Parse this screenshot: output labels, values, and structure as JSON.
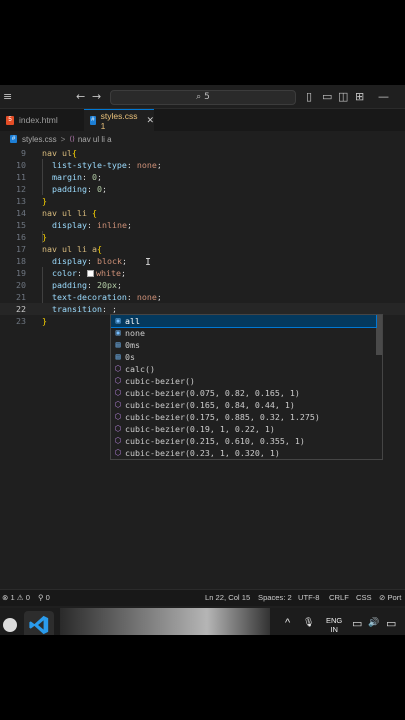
{
  "titlebar": {
    "menu_icon": "≡",
    "back_icon": "←",
    "forward_icon": "→",
    "search_text": "⌕ 5",
    "layout_icons": [
      "▯",
      "▭",
      "◫",
      "⊞"
    ],
    "minimize": "—"
  },
  "tabs": [
    {
      "label": "index.html",
      "icon": "5"
    },
    {
      "label": "styles.css 1",
      "icon": "#",
      "close": "✕"
    }
  ],
  "breadcrumb": {
    "file": "styles.css",
    "sep": ">",
    "symbol_icon": "⟨⟩",
    "symbol": "nav ul li a"
  },
  "editor": {
    "line_numbers": [
      "9",
      "10",
      "11",
      "12",
      "13",
      "14",
      "15",
      "16",
      "17",
      "18",
      "19",
      "20",
      "21",
      "22",
      "23"
    ],
    "lines": [
      [
        [
          "k",
          "nav ul"
        ],
        [
          "b",
          "{"
        ]
      ],
      [
        [
          "p",
          "  list-style-type"
        ],
        [
          "w",
          ": "
        ],
        [
          "v",
          "none"
        ],
        [
          "w",
          ";"
        ]
      ],
      [
        [
          "p",
          "  margin"
        ],
        [
          "w",
          ": "
        ],
        [
          "n",
          "0"
        ],
        [
          "w",
          ";"
        ]
      ],
      [
        [
          "p",
          "  padding"
        ],
        [
          "w",
          ": "
        ],
        [
          "n",
          "0"
        ],
        [
          "w",
          ";"
        ]
      ],
      [
        [
          "b",
          "}"
        ]
      ],
      [
        [
          "k",
          "nav ul li "
        ],
        [
          "b",
          "{"
        ]
      ],
      [
        [
          "p",
          "  display"
        ],
        [
          "w",
          ": "
        ],
        [
          "v",
          "inline"
        ],
        [
          "w",
          ";"
        ]
      ],
      [
        [
          "b",
          "}"
        ]
      ],
      [
        [
          "k",
          "nav ul li a"
        ],
        [
          "b",
          "{"
        ]
      ],
      [
        [
          "p",
          "  display"
        ],
        [
          "w",
          ": "
        ],
        [
          "v",
          "block"
        ],
        [
          "w",
          ";"
        ]
      ],
      [
        [
          "p",
          "  color"
        ],
        [
          "w",
          ": "
        ],
        [
          "swatch",
          ""
        ],
        [
          "v",
          "white"
        ],
        [
          "w",
          ";"
        ]
      ],
      [
        [
          "p",
          "  padding"
        ],
        [
          "w",
          ": "
        ],
        [
          "n",
          "20px"
        ],
        [
          "w",
          ";"
        ]
      ],
      [
        [
          "p",
          "  text-decoration"
        ],
        [
          "w",
          ": "
        ],
        [
          "v",
          "none"
        ],
        [
          "w",
          ";"
        ]
      ],
      [
        [
          "p",
          "  transition"
        ],
        [
          "w",
          ": "
        ],
        [
          "w",
          ";"
        ]
      ],
      [
        [
          "b",
          "}"
        ]
      ]
    ],
    "current_line": "22"
  },
  "suggest": {
    "items": [
      {
        "icon": "value",
        "label": "all"
      },
      {
        "icon": "value",
        "label": "none"
      },
      {
        "icon": "unit",
        "label": "0ms"
      },
      {
        "icon": "unit",
        "label": "0s"
      },
      {
        "icon": "function",
        "label": "calc()"
      },
      {
        "icon": "function",
        "label": "cubic-bezier()"
      },
      {
        "icon": "function",
        "label": "cubic-bezier(0.075, 0.82, 0.165, 1)"
      },
      {
        "icon": "function",
        "label": "cubic-bezier(0.165, 0.84, 0.44, 1)"
      },
      {
        "icon": "function",
        "label": "cubic-bezier(0.175, 0.885, 0.32, 1.275)"
      },
      {
        "icon": "function",
        "label": "cubic-bezier(0.19, 1, 0.22, 1)"
      },
      {
        "icon": "function",
        "label": "cubic-bezier(0.215, 0.610, 0.355, 1)"
      },
      {
        "icon": "function",
        "label": "cubic-bezier(0.23, 1, 0.320, 1)"
      }
    ],
    "selected_index": 0
  },
  "statusbar": {
    "problems": "⊗ 1 ⚠ 0",
    "ports": "⚲ 0",
    "position": "Ln 22, Col 15",
    "spaces": "Spaces: 2",
    "encoding": "UTF-8",
    "eol": "CRLF",
    "language": "CSS",
    "port_label": "⊘ Port"
  },
  "taskbar": {
    "chevron": "^",
    "mic": "🎙",
    "lang_line1": "ENG",
    "lang_line2": "IN",
    "monitor": "▭",
    "speaker": "🔊",
    "battery": "▭"
  }
}
